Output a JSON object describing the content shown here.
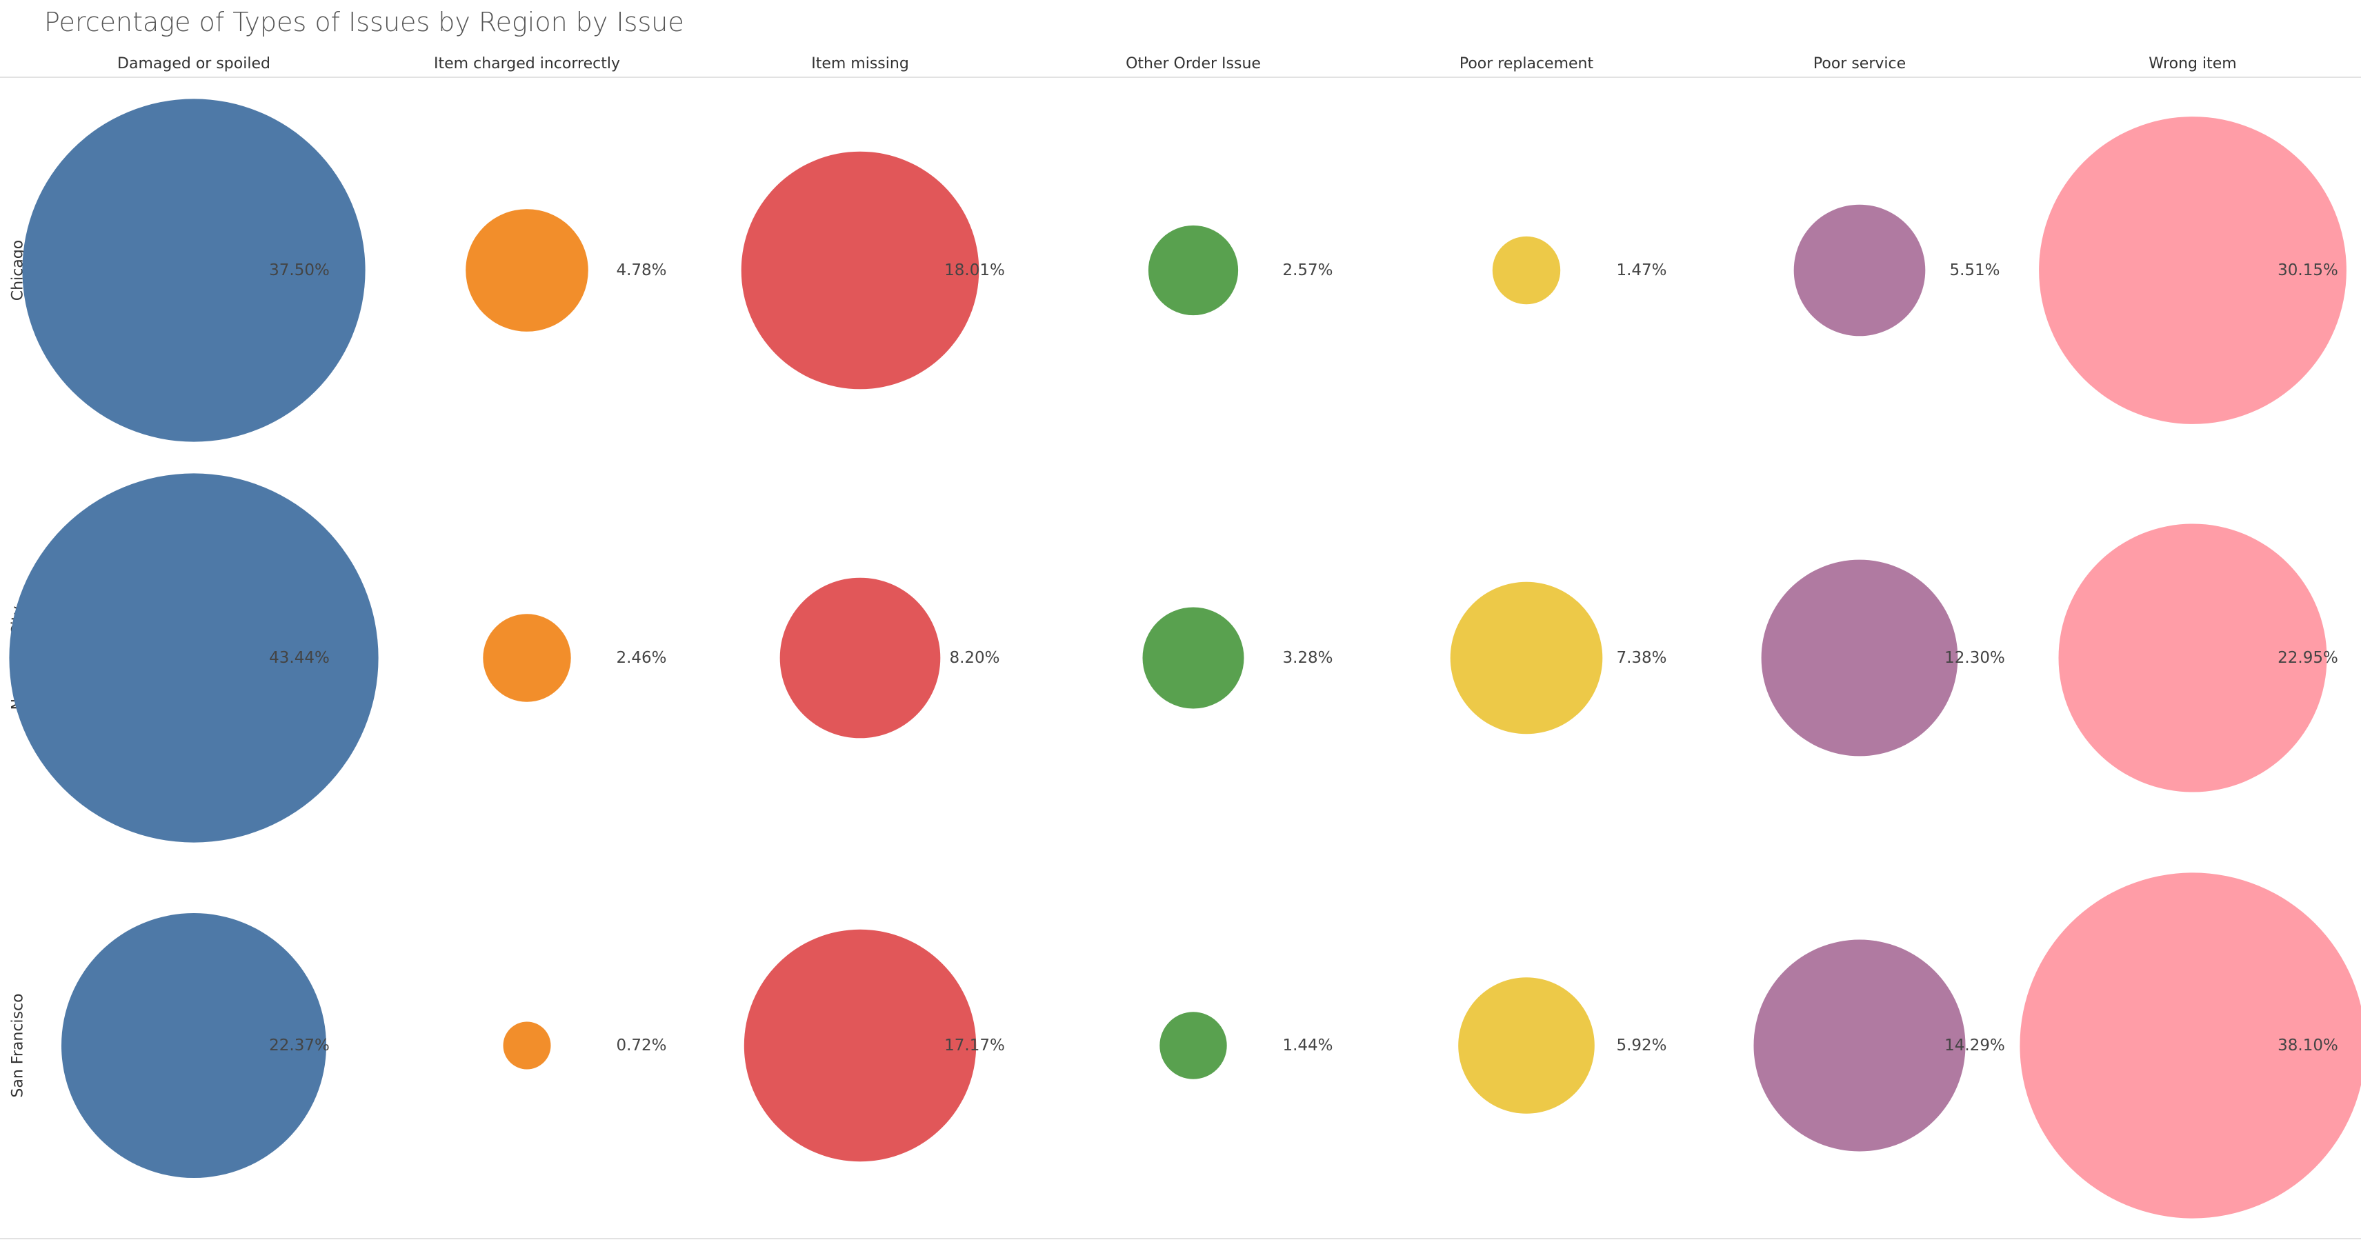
{
  "chart_data": {
    "type": "scatter",
    "title": "Percentage of Types of Issues by Region by Issue",
    "columns": [
      "Damaged or spoiled",
      "Item charged incorrectly",
      "Item missing",
      "Other Order Issue",
      "Poor replacement",
      "Poor service",
      "Wrong item"
    ],
    "rows": [
      "Chicago",
      "New York City",
      "San Francisco"
    ],
    "colors": [
      "#4e79a7",
      "#f28e2b",
      "#e15759",
      "#59a14f",
      "#edc948",
      "#b07aa1",
      "#ff9da7"
    ],
    "series": [
      {
        "name": "Chicago",
        "values": [
          37.5,
          4.78,
          18.01,
          2.57,
          1.47,
          5.51,
          30.15
        ],
        "labels": [
          "37.50%",
          "4.78%",
          "18.01%",
          "2.57%",
          "1.47%",
          "5.51%",
          "30.15%"
        ]
      },
      {
        "name": "New York City",
        "values": [
          43.44,
          2.46,
          8.2,
          3.28,
          7.38,
          12.3,
          22.95
        ],
        "labels": [
          "43.44%",
          "2.46%",
          "8.20%",
          "3.28%",
          "7.38%",
          "12.30%",
          "22.95%"
        ]
      },
      {
        "name": "San Francisco",
        "values": [
          22.37,
          0.72,
          17.17,
          1.44,
          5.92,
          14.29,
          38.1
        ],
        "labels": [
          "22.37%",
          "0.72%",
          "17.17%",
          "1.44%",
          "5.92%",
          "14.29%",
          "38.10%"
        ]
      }
    ],
    "encoding": "bubble area proportional to percentage",
    "grid": false,
    "legend": "none"
  }
}
